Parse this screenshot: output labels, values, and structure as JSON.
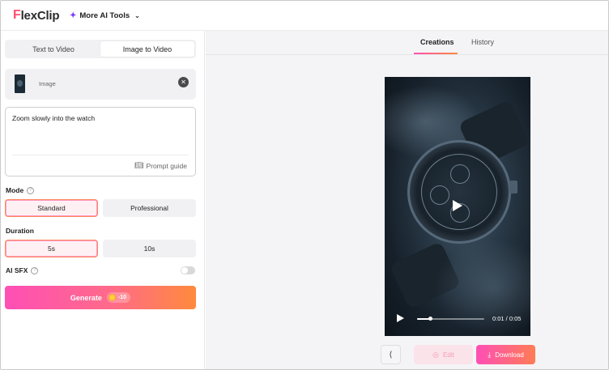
{
  "header": {
    "logo_mark": "F",
    "logo_text": "lexClip",
    "more_tools_label": "More AI Tools",
    "sparkle_icon": "sparkle-icon",
    "chevron_icon": "chevron-down-icon"
  },
  "left": {
    "tabs": [
      {
        "label": "Text to Video",
        "active": false
      },
      {
        "label": "Image to Video",
        "active": true
      }
    ],
    "image_card": {
      "label": "Image"
    },
    "prompt": {
      "text": "Zoom slowly into the watch",
      "guide_label": "Prompt guide"
    },
    "mode": {
      "label": "Mode",
      "options": [
        {
          "label": "Standard",
          "selected": true
        },
        {
          "label": "Professional",
          "selected": false
        }
      ]
    },
    "duration": {
      "label": "Duration",
      "options": [
        {
          "label": "5s",
          "selected": true
        },
        {
          "label": "10s",
          "selected": false
        }
      ]
    },
    "ai_sfx": {
      "label": "AI SFX",
      "enabled": false
    },
    "generate": {
      "label": "Generate",
      "credits": "-10"
    }
  },
  "right": {
    "tabs": [
      {
        "label": "Creations",
        "active": true
      },
      {
        "label": "History",
        "active": false
      }
    ],
    "player": {
      "time": "0:01 / 0:05",
      "progress": 0.2
    },
    "actions": {
      "edit_label": "Edit",
      "download_label": "Download"
    }
  },
  "colors": {
    "accent_pink": "#ff4fb5",
    "accent_orange": "#ff8a3d",
    "panel_gray": "#f1f1f3"
  }
}
